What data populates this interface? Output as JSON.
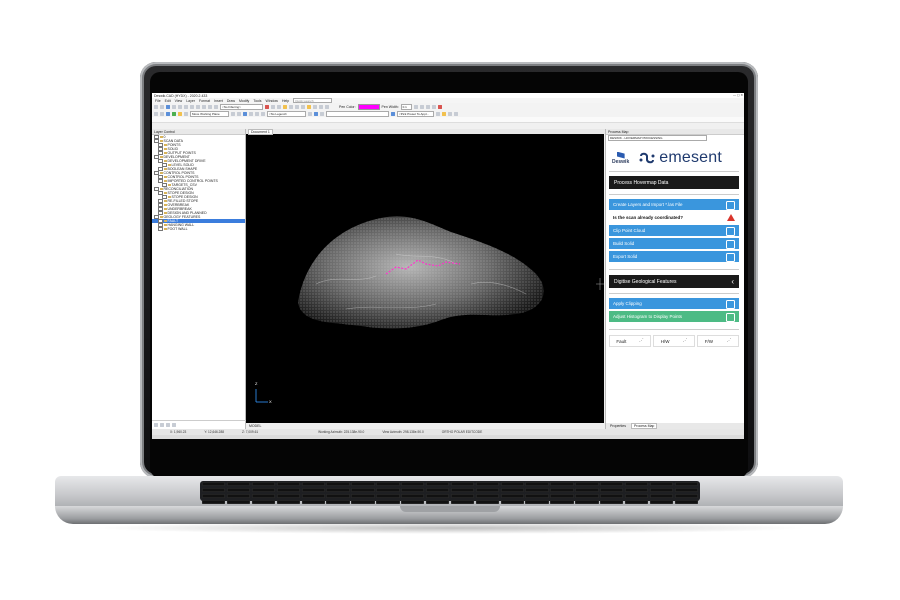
{
  "window": {
    "title": "Deswik.CAD (HYDX) - 2020.2.433",
    "controls": "—  ▢  ✕"
  },
  "menu": {
    "items": [
      "File",
      "Edit",
      "View",
      "Layer",
      "Format",
      "Insert",
      "Draw",
      "Modify",
      "Tools",
      "Window",
      "Help"
    ],
    "search_placeholder": "Quick Launch"
  },
  "toolbar": {
    "filter_combo": "<No Filtering>",
    "move_plane_label": "Move Working Plane",
    "legend_combo": "<No Legend>",
    "pen_color_label": "Pen Color:",
    "pen_width_label": "Pen Width:",
    "pen_width_value": "0.1",
    "pick_preset_label": "<Pick Preset To Appl..."
  },
  "layer_panel": {
    "title": "Layer Control",
    "items": [
      {
        "label": "0",
        "indent": 0,
        "selected": false
      },
      {
        "label": "SCAN DATA",
        "indent": 0,
        "selected": false
      },
      {
        "label": "POINTS",
        "indent": 1,
        "selected": false
      },
      {
        "label": "SOLID",
        "indent": 1,
        "selected": false
      },
      {
        "label": "OUTPUT POINTS",
        "indent": 1,
        "selected": false
      },
      {
        "label": "DEVELOPMENT",
        "indent": 0,
        "selected": false
      },
      {
        "label": "DEVELOPMENT DRIVE",
        "indent": 1,
        "selected": false
      },
      {
        "label": "LEVEL SOLID",
        "indent": 2,
        "selected": false
      },
      {
        "label": "BOOLEAN SHAPE",
        "indent": 1,
        "selected": false
      },
      {
        "label": "CONTROL POINTS",
        "indent": 0,
        "selected": false
      },
      {
        "label": "CONTROL POINTS",
        "indent": 1,
        "selected": false
      },
      {
        "label": "IMPORTED CONTROL POINTS",
        "indent": 1,
        "selected": false
      },
      {
        "label": "TARGETS_CSV",
        "indent": 2,
        "selected": false
      },
      {
        "label": "RECONCILIATION",
        "indent": 0,
        "selected": false
      },
      {
        "label": "STOPE DESIGN",
        "indent": 1,
        "selected": false
      },
      {
        "label": "STOPE DESIGN",
        "indent": 2,
        "selected": false
      },
      {
        "label": "RE-FILLED STOPE",
        "indent": 1,
        "selected": false
      },
      {
        "label": "OVERBREAK",
        "indent": 1,
        "selected": false
      },
      {
        "label": "UNDERBREAK",
        "indent": 1,
        "selected": false
      },
      {
        "label": "DESIGN AND PLANNED",
        "indent": 1,
        "selected": false
      },
      {
        "label": "GEOLOGY FEATURES",
        "indent": 0,
        "selected": false
      },
      {
        "label": "FAULT",
        "indent": 1,
        "selected": true
      },
      {
        "label": "HANGING WALL",
        "indent": 1,
        "selected": false
      },
      {
        "label": "FOOT WALL",
        "indent": 1,
        "selected": false
      }
    ]
  },
  "viewport": {
    "tab_label": "Document 1",
    "bottom_tab": "MODEL",
    "axis_z": "Z",
    "axis_x": "X"
  },
  "process_map": {
    "title": "Process Map",
    "combo_value": "DESWIK - HOVERMAP PROCESSING",
    "deswik_text": "Deswik",
    "emesent_text": "emesent",
    "section1": "Process Hovermap Data",
    "buttons1": [
      {
        "label": "Create Layers and Import *.las File",
        "style": "blue"
      },
      {
        "label": "Is the scan already coordinated?",
        "style": "white"
      },
      {
        "label": "Clip Point Cloud",
        "style": "blue"
      },
      {
        "label": "Build Solid",
        "style": "blue"
      },
      {
        "label": "Export Solid",
        "style": "blue"
      }
    ],
    "section2": "Digitise Geological Features",
    "buttons2": [
      {
        "label": "Apply Clipping",
        "style": "blue"
      },
      {
        "label": "Adjust Histogram to Display Points",
        "style": "green"
      }
    ],
    "fault_buttons": [
      "Fault",
      "H/W",
      "F/W"
    ],
    "tabs": [
      "Properties",
      "Process Map"
    ]
  },
  "statusbar": {
    "x": "X: 1,960.23",
    "y": "Y: 12,646.288",
    "z": "Z: 7,009.61",
    "working_azimuth": "Working Azimuth: 225.138e-90.0",
    "view_azimuth": "View Azimuth: 298.138e-90.0",
    "modes": "ORTHO  POLAR  EDITCODE"
  },
  "colors": {
    "accent_blue": "#3a96dd",
    "accent_green": "#4dbb85",
    "pen_color": "#ff00ff",
    "emesent_navy": "#1f3a6e",
    "warning_red": "#d9342b"
  }
}
